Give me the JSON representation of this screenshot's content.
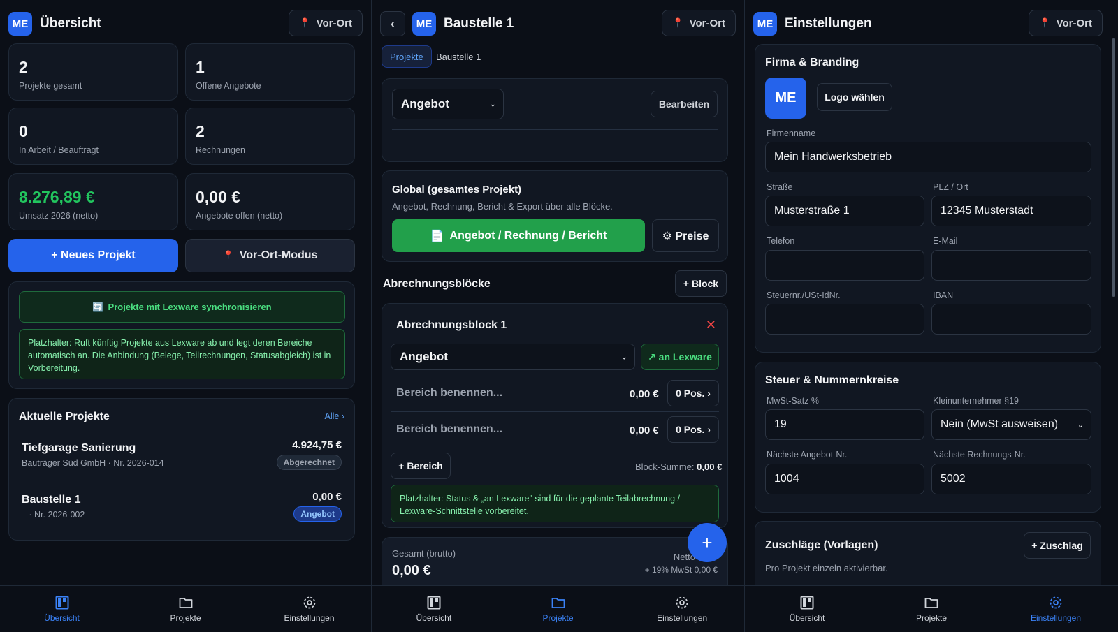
{
  "overview": {
    "badge": "ME",
    "title": "Übersicht",
    "onsite_label": "Vor-Ort",
    "stats": [
      {
        "value": "2",
        "label": "Projekte gesamt"
      },
      {
        "value": "1",
        "label": "Offene Angebote"
      },
      {
        "value": "0",
        "label": "In Arbeit / Beauftragt"
      },
      {
        "value": "2",
        "label": "Rechnungen"
      },
      {
        "value": "8.276,89 €",
        "label": "Umsatz 2026 (netto)"
      },
      {
        "value": "0,00 €",
        "label": "Angebote offen (netto)"
      }
    ],
    "new_project": "+ Neues Projekt",
    "onsite_mode": "Vor-Ort-Modus",
    "sync_button": "Projekte mit Lexware synchronisieren",
    "sync_note": "Platzhalter: Ruft künftig Projekte aus Lexware ab und legt deren Bereiche automatisch an. Die Anbindung (Belege, Teilrechnungen, Statusabgleich) ist in Vorbereitung.",
    "recent_title": "Aktuelle Projekte",
    "all_link": "Alle ›",
    "projects": [
      {
        "name": "Tiefgarage Sanierung",
        "sub": "Bauträger Süd GmbH · Nr. 2026-014",
        "amount": "4.924,75 €",
        "status": "Abgerechnet"
      },
      {
        "name": "Baustelle 1",
        "sub": "– · Nr. 2026-002",
        "amount": "0,00 €",
        "status": "Angebot"
      }
    ]
  },
  "project": {
    "back": "‹",
    "badge": "ME",
    "title": "Baustelle 1",
    "onsite_label": "Vor-Ort",
    "breadcrumb_projects": "Projekte",
    "breadcrumb_current": "Baustelle 1",
    "status_select": "Angebot",
    "edit_button": "Bearbeiten",
    "dash": "–",
    "global_title": "Global (gesamtes Projekt)",
    "global_sub": "Angebot, Rechnung, Bericht & Export über alle Blöcke.",
    "doc_button": "Angebot / Rechnung / Bericht",
    "prices_button": "⚙ Preise",
    "blocks_title": "Abrechnungsblöcke",
    "add_block": "+ Block",
    "block": {
      "title": "Abrechnungsblock 1",
      "status": "Angebot",
      "lexware_button": "↗ an Lexware",
      "rows": [
        {
          "name": "Bereich benennen...",
          "amount": "0,00 €",
          "pos": "0 Pos. ›"
        },
        {
          "name": "Bereich benennen...",
          "amount": "0,00 €",
          "pos": "0 Pos. ›"
        }
      ],
      "add_area": "+ Bereich",
      "sum_label": "Block-Summe:",
      "sum_value": "0,00 €",
      "note": "Platzhalter: Status & „an Lexware\" sind für die geplante Teilabrechnung / Lexware-Schnittstelle vorbereitet."
    },
    "total_label": "Gesamt (brutto)",
    "total_value": "0,00 €",
    "net_label": "Netto",
    "vat_label": "+ 19% MwSt 0,00 €",
    "fab": "+"
  },
  "settings": {
    "badge": "ME",
    "title": "Einstellungen",
    "onsite_label": "Vor-Ort",
    "branding_title": "Firma & Branding",
    "logo_text": "ME",
    "logo_button": "Logo wählen",
    "company_label": "Firmenname",
    "company_value": "Mein Handwerksbetrieb",
    "street_label": "Straße",
    "street_value": "Musterstraße 1",
    "city_label": "PLZ / Ort",
    "city_value": "12345 Musterstadt",
    "phone_label": "Telefon",
    "phone_value": "",
    "email_label": "E-Mail",
    "email_value": "",
    "tax_label": "Steuernr./USt-IdNr.",
    "tax_value": "",
    "iban_label": "IBAN",
    "iban_value": "",
    "tax_section_title": "Steuer & Nummernkreise",
    "vat_label": "MwSt-Satz %",
    "vat_value": "19",
    "small_business_label": "Kleinunternehmer §19",
    "small_business_value": "Nein (MwSt ausweisen)",
    "next_offer_label": "Nächste Angebot-Nr.",
    "next_offer_value": "1004",
    "next_invoice_label": "Nächste Rechnungs-Nr.",
    "next_invoice_value": "5002",
    "surcharge_title": "Zuschläge (Vorlagen)",
    "add_surcharge": "+ Zuschlag",
    "surcharge_sub": "Pro Projekt einzeln aktivierbar."
  },
  "nav": {
    "overview": "Übersicht",
    "projects": "Projekte",
    "settings": "Einstellungen"
  },
  "colors": {
    "accent": "#2563eb",
    "success": "#22c55e",
    "danger": "#ef4444",
    "background": "#0b0f17",
    "card": "#111722"
  }
}
